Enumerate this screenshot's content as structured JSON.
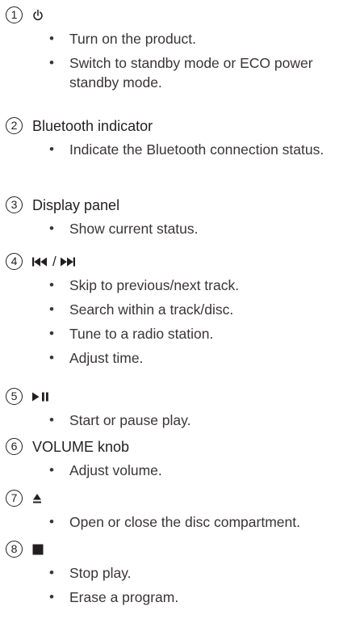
{
  "items": [
    {
      "number": "1",
      "icon": "power-icon",
      "title": "",
      "bullets": [
        "Turn on the product.",
        "Switch to standby mode or ECO power standby mode."
      ]
    },
    {
      "number": "2",
      "title": "Bluetooth indicator",
      "bullets": [
        "Indicate the Bluetooth connection status."
      ]
    },
    {
      "number": "3",
      "title": "Display panel",
      "bullets": [
        "Show current status."
      ]
    },
    {
      "number": "4",
      "icon": "skip-previous-next-icon",
      "separator": "/",
      "bullets": [
        "Skip to previous/next track.",
        "Search within a track/disc.",
        "Tune to a radio station.",
        "Adjust time."
      ]
    },
    {
      "number": "5",
      "icon": "play-pause-icon",
      "bullets": [
        "Start or pause play."
      ]
    },
    {
      "number": "6",
      "title": "VOLUME knob",
      "bullets": [
        "Adjust volume."
      ]
    },
    {
      "number": "7",
      "icon": "eject-icon",
      "bullets": [
        "Open or close the disc compartment."
      ]
    },
    {
      "number": "8",
      "icon": "stop-icon",
      "bullets": [
        "Stop play.",
        "Erase a program."
      ]
    }
  ],
  "bullet_char": "•"
}
